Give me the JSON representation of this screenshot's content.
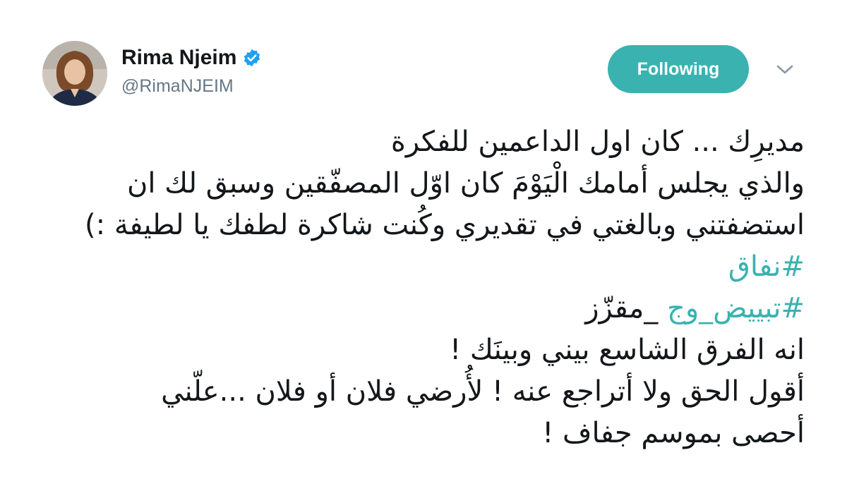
{
  "user": {
    "display_name": "Rima Njeim",
    "handle": "@RimaNJEIM",
    "verified": true,
    "avatar_icon": "profile-photo"
  },
  "follow_button": {
    "label": "Following",
    "color": "#3ab2b0"
  },
  "menu": {
    "icon": "chevron-down-icon"
  },
  "tweet": {
    "line1": "مديرِك ... كان اول الداعمين للفكرة",
    "line2": "والذي يجلس أمامك الْيَوْمَ كان اوّل المصفّقين وسبق لك ان",
    "line3": "استضفتني وبالغتي في تقديري وكُنت شاكرة لطفك يا لطيفة :)",
    "hashtag1": "#نفاق",
    "hashtag2": "#تبييض_وج",
    "line5_tail": " _مقزّز",
    "line6": "انه الفرق الشاسع بيني وبينَك  !",
    "line7": "أقول الحق ولا أتراجع عنه ! لأُرضي فلان أو فلان  ...علّني",
    "line8": "أحصى بموسم جفاف !"
  }
}
